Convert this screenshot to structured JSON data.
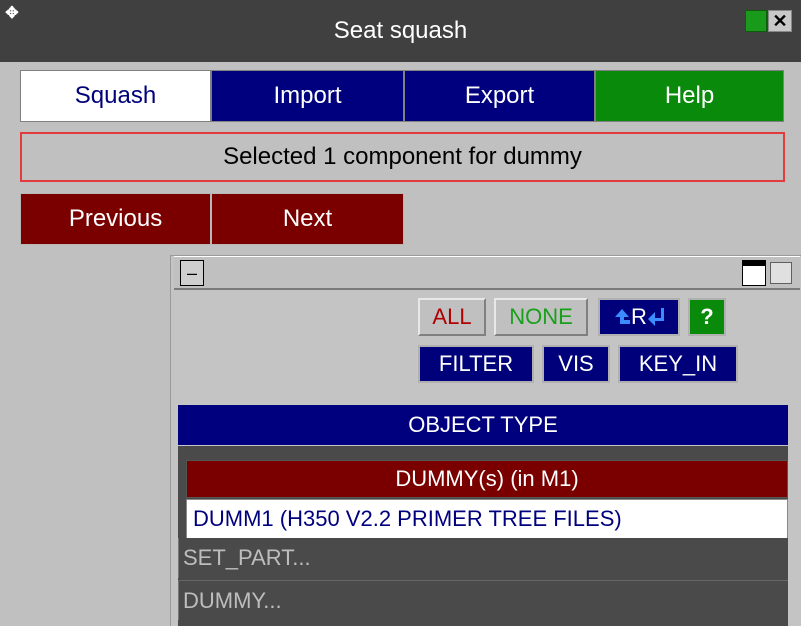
{
  "window": {
    "title": "Seat squash",
    "move_icon": "move-icon",
    "close_icon": "close-icon",
    "close_label": "✕"
  },
  "tabs": [
    {
      "label": "Squash",
      "active": true
    },
    {
      "label": "Import"
    },
    {
      "label": "Export"
    },
    {
      "label": "Help"
    }
  ],
  "status": {
    "message": "Selected 1 component for dummy"
  },
  "nav": {
    "previous": "Previous",
    "next": "Next"
  },
  "selector": {
    "buttons": {
      "all": "ALL",
      "none": "NONE",
      "reverse": "R",
      "help": "?",
      "filter": "FILTER",
      "vis": "VIS",
      "key_in": "KEY_IN"
    },
    "object_type_header": "OBJECT TYPE",
    "selected_type_header": "DUMMY(s) (in M1)",
    "selected_item": "DUMM1 (H350 V2.2 PRIMER TREE FILES)",
    "list_items": [
      "SET_PART...",
      "DUMMY..."
    ]
  },
  "colors": {
    "title_bg": "#404040",
    "window_bg": "#c0c0c0",
    "tab_blue": "#00007f",
    "help_green": "#0a8a0a",
    "nav_red": "#7a0000",
    "status_border": "#e23b3b"
  }
}
